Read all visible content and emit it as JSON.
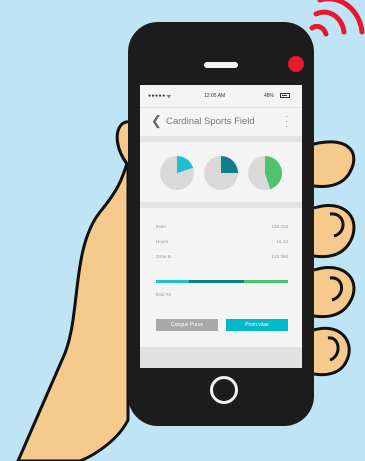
{
  "status": {
    "signal": "●●●●●",
    "wifi": "ᯤ",
    "time": "12:05 AM",
    "battery": "48%"
  },
  "header": {
    "title": "Cardinal Sports Field"
  },
  "pies": [
    {
      "value": 0.2,
      "color": "#1ec0d2"
    },
    {
      "value": 0.25,
      "color": "#0f7f8c"
    },
    {
      "value": 0.45,
      "color": "#4fc26e"
    }
  ],
  "stats": [
    {
      "label": "KwH",
      "value": "148.315"
    },
    {
      "label": "Hours",
      "value": "16.34"
    },
    {
      "label": "Zone B",
      "value": "122.390"
    }
  ],
  "bar_segments": [
    {
      "fraction": 0.25,
      "color": "#1ec0d2"
    },
    {
      "fraction": 0.42,
      "color": "#0f7f8c"
    },
    {
      "fraction": 0.33,
      "color": "#4fc26e"
    }
  ],
  "field_label": "field #4",
  "buttons": {
    "left": "Congue Purus",
    "right": "Proin vitae"
  },
  "colors": {
    "background": "#bfe4f5",
    "phone": "#1c1c1c",
    "led": "#e8192c",
    "accent": "#00b8cc"
  }
}
